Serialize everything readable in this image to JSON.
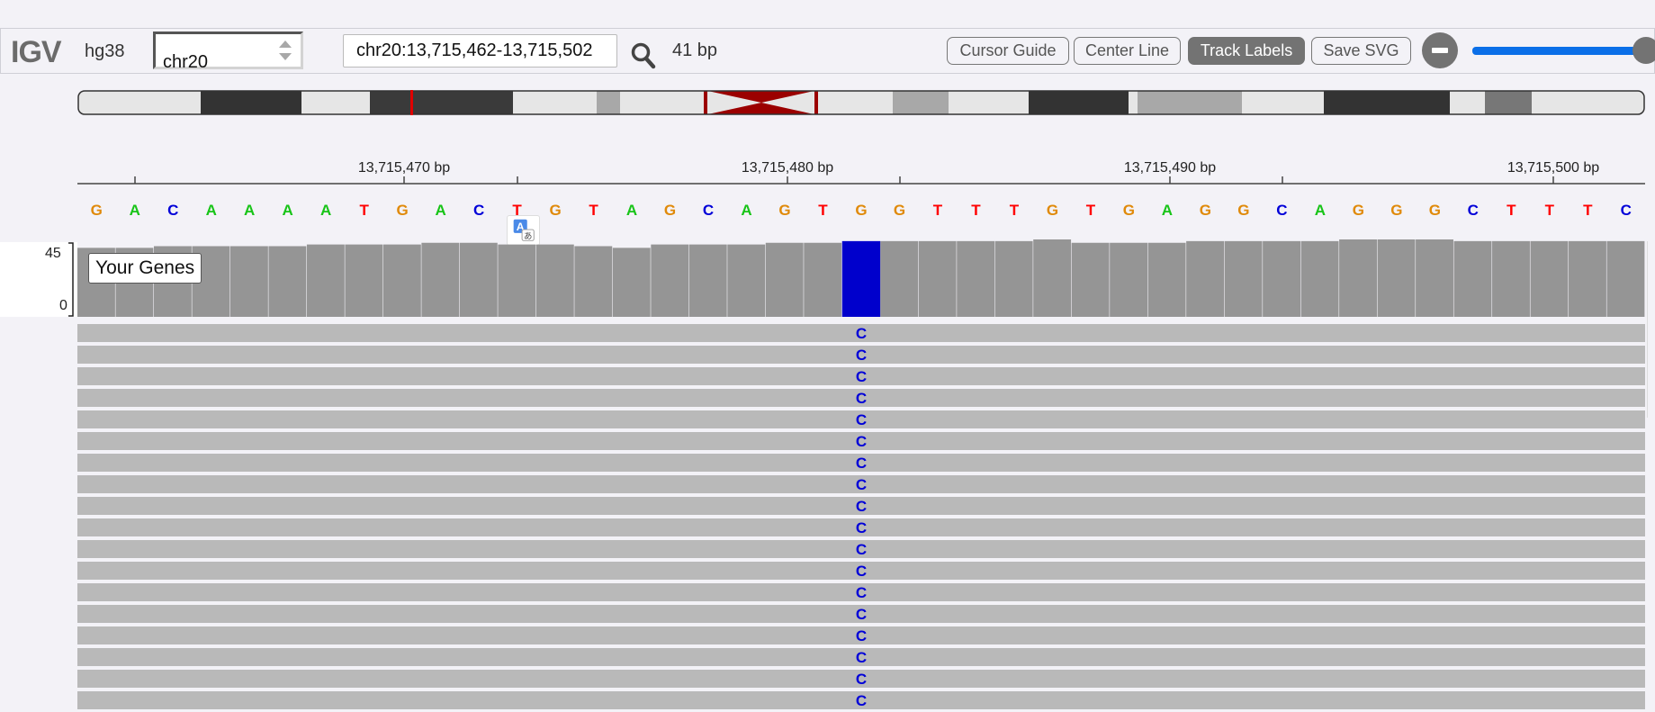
{
  "app": {
    "logo": "IGV",
    "genome": "hg38"
  },
  "navbar": {
    "chromosome": "chr20",
    "locus": "chr20:13,715,462-13,715,502",
    "width_label": "41 bp",
    "buttons": {
      "cursor_guide": "Cursor Guide",
      "center_line": "Center Line",
      "track_labels": "Track Labels",
      "save_svg": "Save SVG"
    },
    "zoom_level": 0.98
  },
  "ruler": {
    "ticks": [
      "13,715,470 bp",
      "13,715,480 bp",
      "13,715,490 bp",
      "13,715,500 bp"
    ]
  },
  "sequence": {
    "bases": [
      "G",
      "A",
      "C",
      "A",
      "A",
      "A",
      "A",
      "T",
      "G",
      "A",
      "C",
      "T",
      "G",
      "T",
      "A",
      "G",
      "C",
      "A",
      "G",
      "T",
      "G",
      "G",
      "T",
      "T",
      "T",
      "G",
      "T",
      "G",
      "A",
      "G",
      "G",
      "C",
      "A",
      "G",
      "G",
      "G",
      "C",
      "T",
      "T",
      "T",
      "C"
    ]
  },
  "colors": {
    "A": "#18c418",
    "C": "#0000d8",
    "G": "#e08a0a",
    "T": "#ff0000",
    "coverage": "#959595",
    "read": "#b9b9b9",
    "mismatch_bar": "#0000cc",
    "accent": "#0b6fe8"
  },
  "coverage_track": {
    "label": "Your Genes",
    "scale_max": "45",
    "scale_min": "0",
    "depth": [
      41,
      41,
      42,
      42,
      42,
      42,
      43,
      43,
      43,
      44,
      44,
      43,
      43,
      42,
      41,
      43,
      43,
      43,
      44,
      44,
      45,
      45,
      45,
      45,
      45,
      46,
      44,
      44,
      44,
      45,
      45,
      45,
      45,
      46,
      46,
      46,
      45,
      45,
      45,
      45,
      45
    ],
    "variant_index": 20
  },
  "alignments": {
    "mismatch_base": "C",
    "row_count": 18
  }
}
